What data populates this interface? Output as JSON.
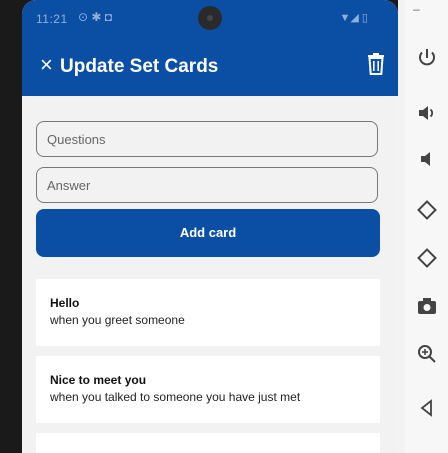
{
  "statusbar": {
    "time": "11:21",
    "icons_text": "⊙ ✱ ◘",
    "right_text": "▼◢ ▯"
  },
  "appbar": {
    "close_glyph": "×",
    "title": "Update Set Cards",
    "trash_icon": "trash-icon"
  },
  "form": {
    "question_placeholder": "Questions",
    "answer_placeholder": "Answer",
    "add_button_label": "Add card"
  },
  "cards": [
    {
      "question": "Hello",
      "answer": "when you greet someone"
    },
    {
      "question": "Nice to meet you",
      "answer": "when you talked to someone you have just met"
    }
  ],
  "emulator_toolbar": {
    "minimize_glyph": "–",
    "buttons": [
      "power-icon",
      "volume-up-icon",
      "volume-down-icon",
      "rotate-left-icon",
      "rotate-right-icon",
      "camera-icon",
      "zoom-icon",
      "back-icon"
    ]
  },
  "colors": {
    "primary": "#0b4fa4",
    "background": "#f2f2f2",
    "card": "#ffffff"
  }
}
